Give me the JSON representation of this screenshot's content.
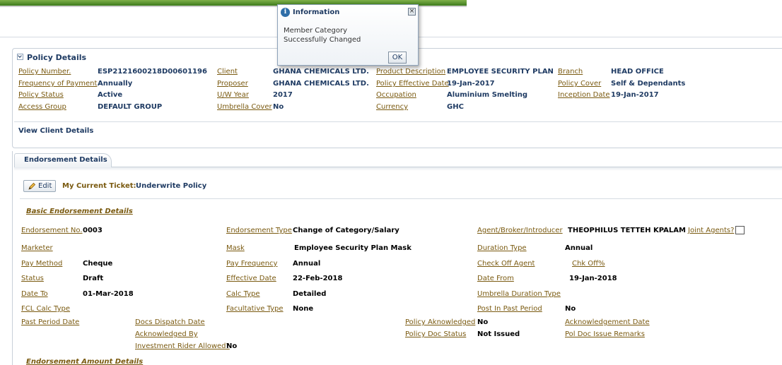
{
  "popup": {
    "title": "Information",
    "message": "Member Category Successfully Changed",
    "ok_label": "OK"
  },
  "policy_details": {
    "header": "Policy Details",
    "fields": {
      "policy_number_label": "Policy Number.",
      "policy_number": "ESP2121600218D00601196",
      "client_label": "Client",
      "client": "GHANA CHEMICALS LTD.",
      "product_label": "Product Description",
      "product": "EMPLOYEE SECURITY PLAN",
      "branch_label": "Branch",
      "branch": "HEAD OFFICE",
      "frequency_label": "Frequency of Payment",
      "frequency": "Annually",
      "proposer_label": "Proposer",
      "proposer": "GHANA CHEMICALS LTD.",
      "effective_label": "Policy Effective Date",
      "effective": "19-Jan-2017",
      "cover_label": "Policy Cover",
      "cover": "Self & Dependants",
      "status_label": "Policy Status",
      "status": "Active",
      "uw_year_label": "U/W Year",
      "uw_year": "2017",
      "occupation_label": "Occupation",
      "occupation": "Aluminium Smelting",
      "inception_label": "Inception Date",
      "inception": "19-Jan-2017",
      "access_label": "Access Group",
      "access": "DEFAULT GROUP",
      "umbrella_label": "Umbrella Cover",
      "umbrella": "No",
      "currency_label": "Currency",
      "currency": "GHC"
    },
    "view_client_link": "View Client Details"
  },
  "endorsement": {
    "tab_label": "Endorsement Details",
    "edit_label": "Edit",
    "ticket_label": "My Current Ticket:",
    "ticket_value": "Underwrite Policy",
    "basic_title": "Basic Endorsement Details",
    "amount_title": "Endorsement Amount Details",
    "fields": {
      "end_no_label": "Endorsement No.",
      "end_no": "0003",
      "end_type_label": "Endorsement Type",
      "end_type": "Change of Category/Salary",
      "agent_label": "Agent/Broker/Introducer",
      "agent": "THEOPHILUS TETTEH KPALAM",
      "joint_agents_label": "Joint Agents?",
      "marketer_label": "Marketer",
      "mask_label": "Mask",
      "mask": "Employee Security Plan Mask",
      "duration_type_label": "Duration Type",
      "duration_type": "Annual",
      "pay_method_label": "Pay Method",
      "pay_method": "Cheque",
      "pay_freq_label": "Pay Frequency",
      "pay_freq": "Annual",
      "checkoff_label": "Check Off Agent",
      "chk_off_label": "Chk Off%",
      "status_label": "Status",
      "status": "Draft",
      "eff_date_label": "Effective Date",
      "eff_date": "22-Feb-2018",
      "date_from_label": "Date From",
      "date_from": "19-Jan-2018",
      "date_to_label": "Date To",
      "date_to": "01-Mar-2018",
      "calc_type_label": "Calc Type",
      "calc_type": "Detailed",
      "umbrella_dur_label": "Umbrella Duration Type",
      "fcl_label": "FCL Calc Type",
      "facultative_label": "Facultative Type",
      "facultative": "None",
      "post_past_label": "Post In Past Period",
      "post_past": "No",
      "past_period_label": "Past Period Date",
      "docs_dispatch_label": "Docs Dispatch Date",
      "policy_ack_label": "Policy Aknowledged",
      "policy_ack": "No",
      "ack_date_label": "Acknowledgement Date",
      "ack_by_label": "Acknowledged By",
      "doc_status_label": "Policy Doc Status",
      "doc_status": "Not Issued",
      "doc_remarks_label": "Pol Doc Issue Remarks",
      "rider_label": "Investment Rider Allowed?",
      "rider": "No"
    }
  },
  "colors": {
    "label": "#7a5a10",
    "value_blue": "#1f3b63",
    "border": "#c8d0d9"
  }
}
